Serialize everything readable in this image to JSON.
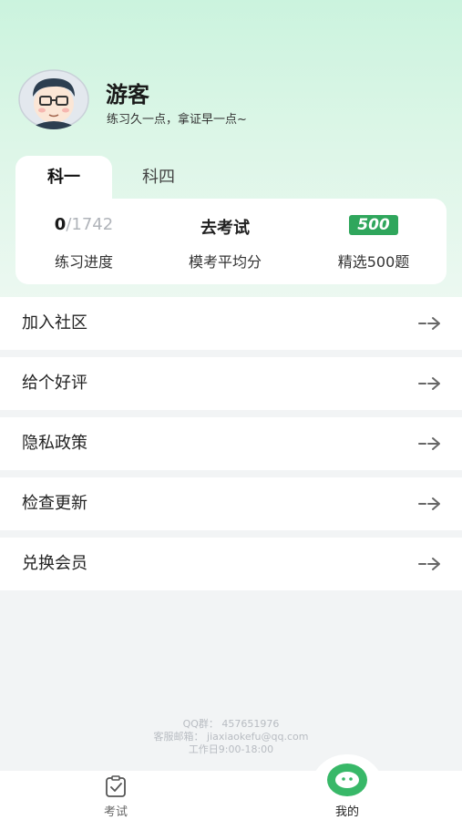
{
  "profile": {
    "username": "游客",
    "motto": "练习久一点，拿证早一点~"
  },
  "tabs": [
    {
      "label": "科一",
      "active": true
    },
    {
      "label": "科四",
      "active": false
    }
  ],
  "stats": {
    "progress_done": "0",
    "progress_total": "/1742",
    "progress_label": "练习进度",
    "exam_title": "去考试",
    "exam_label": "模考平均分",
    "selected_badge": "500",
    "selected_label": "精选500题"
  },
  "menu": [
    {
      "label": "加入社区",
      "icon": "arrow-right-icon"
    },
    {
      "label": "给个好评",
      "icon": "arrow-right-icon"
    },
    {
      "label": "隐私政策",
      "icon": "arrow-right-icon"
    },
    {
      "label": "检查更新",
      "icon": "arrow-right-icon"
    },
    {
      "label": "兑换会员",
      "icon": "arrow-right-icon"
    }
  ],
  "footer": {
    "qq": "QQ群：  457651976",
    "email": "客服邮箱：  jiaxiaokefu@qq.com",
    "hours": "工作日9:00-18:00"
  },
  "tabbar": {
    "exam_label": "考试",
    "mine_label": "我的"
  },
  "colors": {
    "accent": "#2fa65c",
    "header_gradient_top": "#cbf3de",
    "background": "#f2f4f5"
  }
}
